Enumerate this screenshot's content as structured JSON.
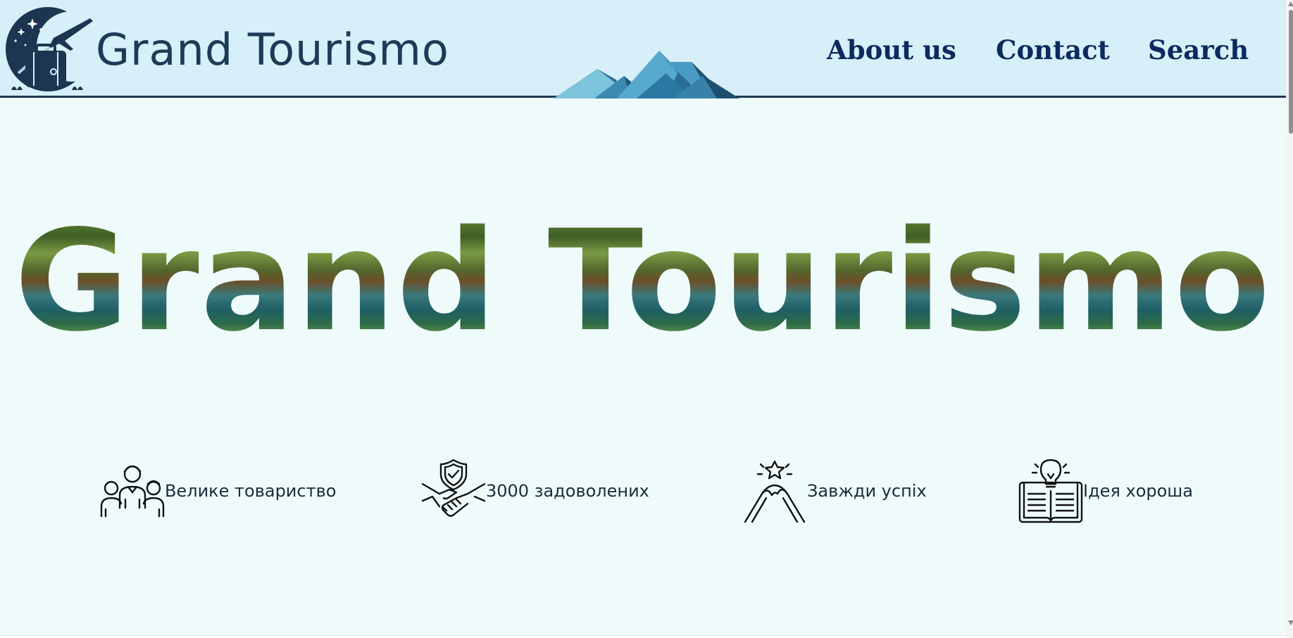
{
  "header": {
    "brand": "Grand Tourismo",
    "logo_icon": "travel-suitcase-plane-logo",
    "decoration_icon": "mountains-icon",
    "nav": [
      {
        "label": "About us"
      },
      {
        "label": "Contact"
      },
      {
        "label": "Search"
      }
    ]
  },
  "hero": {
    "title": "Grand Tourismo"
  },
  "features": [
    {
      "icon": "people-group-icon",
      "label": "Велике товариство"
    },
    {
      "icon": "handshake-shield-icon",
      "label": "3000 задоволених"
    },
    {
      "icon": "mountain-star-icon",
      "label": "Завжди успіх"
    },
    {
      "icon": "book-lightbulb-icon",
      "label": "Ідея хороша"
    }
  ],
  "colors": {
    "header_background": "#d6eff8",
    "page_background": "#effbfb",
    "brand_text": "#1d3a56",
    "nav_text": "#0c2a5e",
    "header_border": "#1c3a50"
  }
}
